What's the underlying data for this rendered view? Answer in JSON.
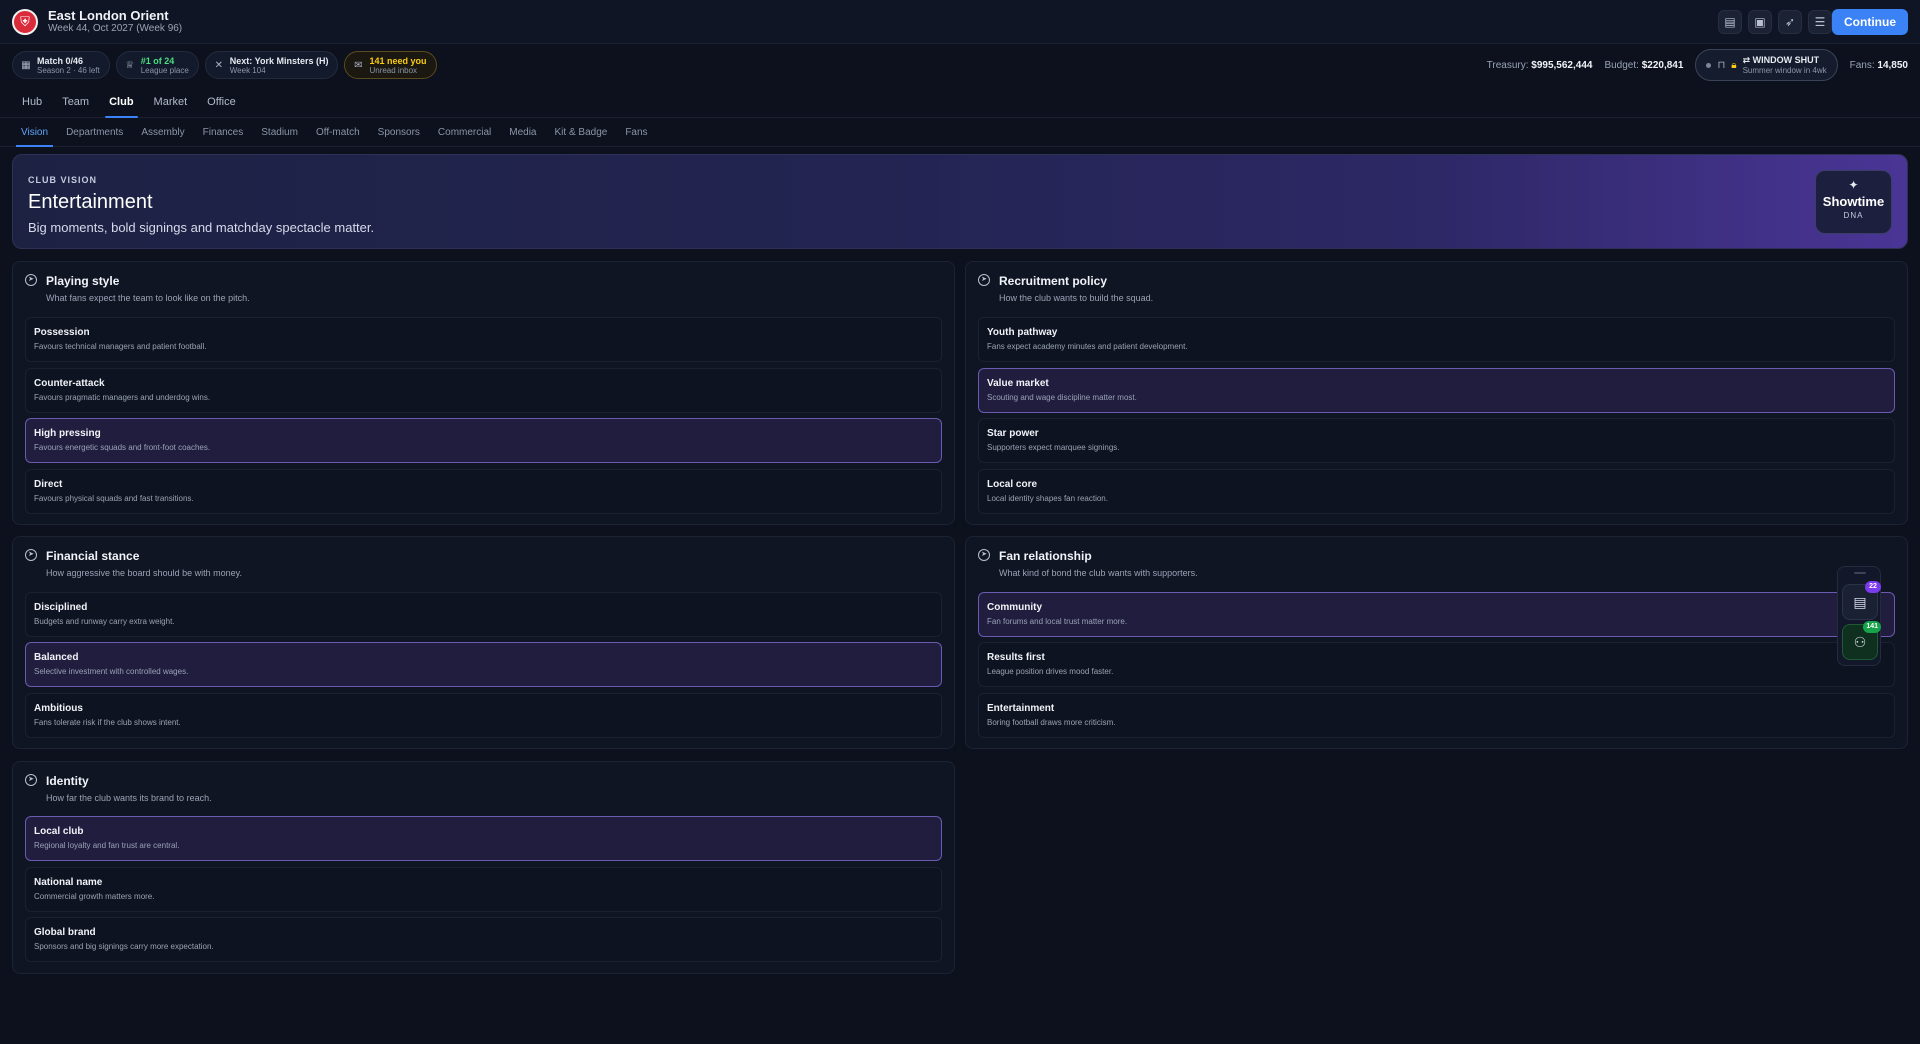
{
  "header": {
    "club_name": "East London Orient",
    "date_line": "Week 44, Oct 2027 (Week 96)",
    "continue_label": "Continue",
    "icons": [
      "clipboard-icon",
      "save-icon",
      "rocket-icon",
      "sliders-icon"
    ]
  },
  "status": {
    "match": {
      "title": "Match 0/46",
      "sub": "Season 2 · 46 left"
    },
    "league": {
      "title": "#1 of 24",
      "sub": "League place"
    },
    "next": {
      "title": "Next: York Minsters (H)",
      "sub": "Week 104"
    },
    "inbox": {
      "title": "141 need you",
      "sub": "Unread inbox"
    },
    "treasury_label": "Treasury:",
    "treasury_value": "$995,562,444",
    "budget_label": "Budget:",
    "budget_value": "$220,841",
    "window": {
      "title": "WINDOW SHUT",
      "sub": "Summer window in 4wk"
    },
    "fans_label": "Fans:",
    "fans_value": "14,850"
  },
  "main_tabs": [
    "Hub",
    "Team",
    "Club",
    "Market",
    "Office"
  ],
  "sub_tabs": [
    "Vision",
    "Departments",
    "Assembly",
    "Finances",
    "Stadium",
    "Off-match",
    "Sponsors",
    "Commercial",
    "Media",
    "Kit & Badge",
    "Fans"
  ],
  "hero": {
    "eyebrow": "CLUB VISION",
    "title": "Entertainment",
    "subtitle": "Big moments, bold signings and matchday spectacle matter.",
    "dna_name": "Showtime",
    "dna_label": "DNA"
  },
  "panels": {
    "playing_style": {
      "title": "Playing style",
      "subtitle": "What fans expect the team to look like on the pitch.",
      "options": [
        {
          "name": "Possession",
          "desc": "Favours technical managers and patient football."
        },
        {
          "name": "Counter-attack",
          "desc": "Favours pragmatic managers and underdog wins."
        },
        {
          "name": "High pressing",
          "desc": "Favours energetic squads and front-foot coaches."
        },
        {
          "name": "Direct",
          "desc": "Favours physical squads and fast transitions."
        }
      ]
    },
    "recruitment": {
      "title": "Recruitment policy",
      "subtitle": "How the club wants to build the squad.",
      "options": [
        {
          "name": "Youth pathway",
          "desc": "Fans expect academy minutes and patient development."
        },
        {
          "name": "Value market",
          "desc": "Scouting and wage discipline matter most."
        },
        {
          "name": "Star power",
          "desc": "Supporters expect marquee signings."
        },
        {
          "name": "Local core",
          "desc": "Local identity shapes fan reaction."
        }
      ]
    },
    "financial": {
      "title": "Financial stance",
      "subtitle": "How aggressive the board should be with money.",
      "options": [
        {
          "name": "Disciplined",
          "desc": "Budgets and runway carry extra weight."
        },
        {
          "name": "Balanced",
          "desc": "Selective investment with controlled wages."
        },
        {
          "name": "Ambitious",
          "desc": "Fans tolerate risk if the club shows intent."
        }
      ]
    },
    "fan_relationship": {
      "title": "Fan relationship",
      "subtitle": "What kind of bond the club wants with supporters.",
      "options": [
        {
          "name": "Community",
          "desc": "Fan forums and local trust matter more."
        },
        {
          "name": "Results first",
          "desc": "League position drives mood faster."
        },
        {
          "name": "Entertainment",
          "desc": "Boring football draws more criticism."
        }
      ]
    },
    "identity": {
      "title": "Identity",
      "subtitle": "How far the club wants its brand to reach.",
      "options": [
        {
          "name": "Local club",
          "desc": "Regional loyalty and fan trust are central."
        },
        {
          "name": "National name",
          "desc": "Commercial growth matters more."
        },
        {
          "name": "Global brand",
          "desc": "Sponsors and big signings carry more expectation."
        }
      ]
    }
  },
  "dock": {
    "tasks_badge": "22",
    "people_badge": "141"
  },
  "colors": {
    "accent": "#3b82f6",
    "selected_border": "#6a5bb0",
    "background": "#0c111d"
  }
}
